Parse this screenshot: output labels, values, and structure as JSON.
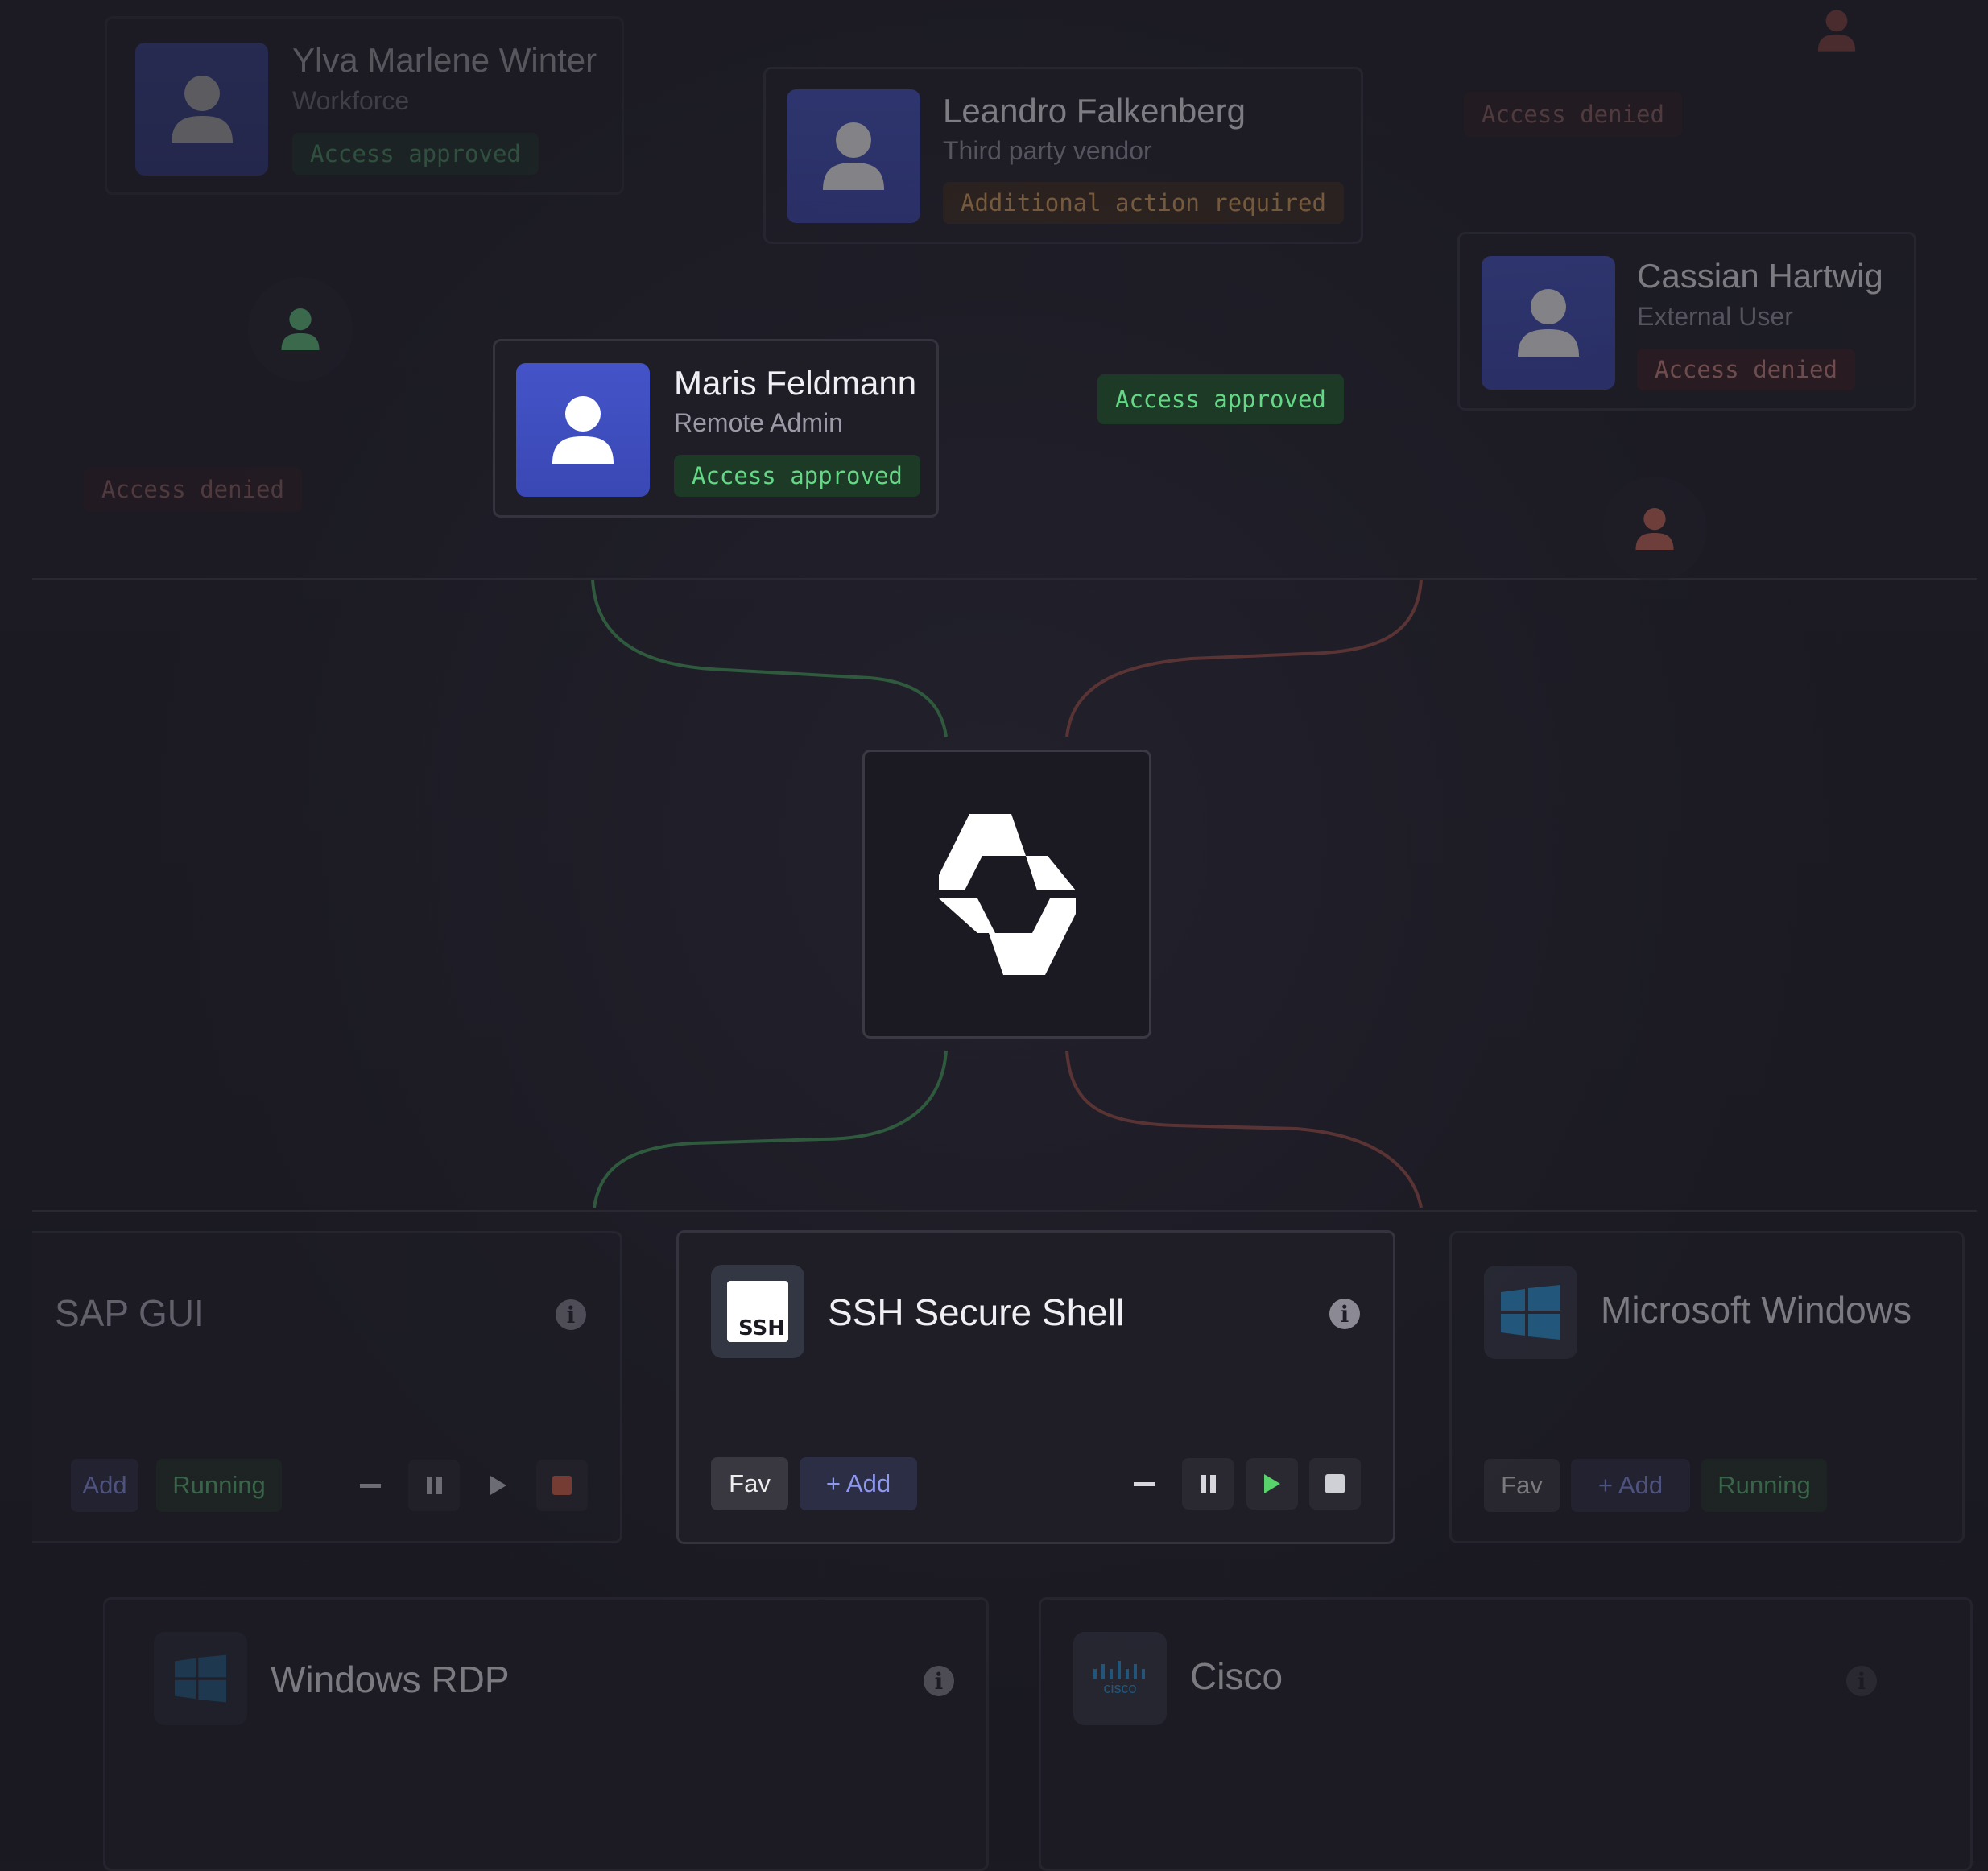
{
  "users": {
    "yiva": {
      "name": "Ylva Marlene Winter",
      "role": "Workforce",
      "status": "Access approved"
    },
    "leandro": {
      "name": "Leandro Falkenberg",
      "role": "Third party vendor",
      "status": "Additional action required"
    },
    "cassian": {
      "name": "Cassian Hartwig",
      "role": "External User",
      "status": "Access denied"
    },
    "maris": {
      "name": "Maris Feldmann",
      "role": "Remote Admin",
      "status": "Access approved"
    }
  },
  "floating_badges": {
    "top_right": "Access denied",
    "left": "Access denied",
    "center": "Access approved"
  },
  "apps": {
    "sap": {
      "title": "SAP GUI",
      "add": "Add",
      "running": "Running"
    },
    "ssh": {
      "title": "SSH Secure Shell",
      "icon_text": "SSH",
      "fav": "Fav",
      "add": "+ Add"
    },
    "windows": {
      "title": "Microsoft Windows",
      "fav": "Fav",
      "add": "+ Add",
      "running": "Running"
    },
    "rdp": {
      "title": "Windows RDP"
    },
    "cisco": {
      "title": "Cisco",
      "icon_text": "cisco"
    }
  },
  "colors": {
    "approved": "#63d985",
    "denied": "#d48a84",
    "warning": "#e0a45a",
    "avatar": "#4454c8"
  }
}
